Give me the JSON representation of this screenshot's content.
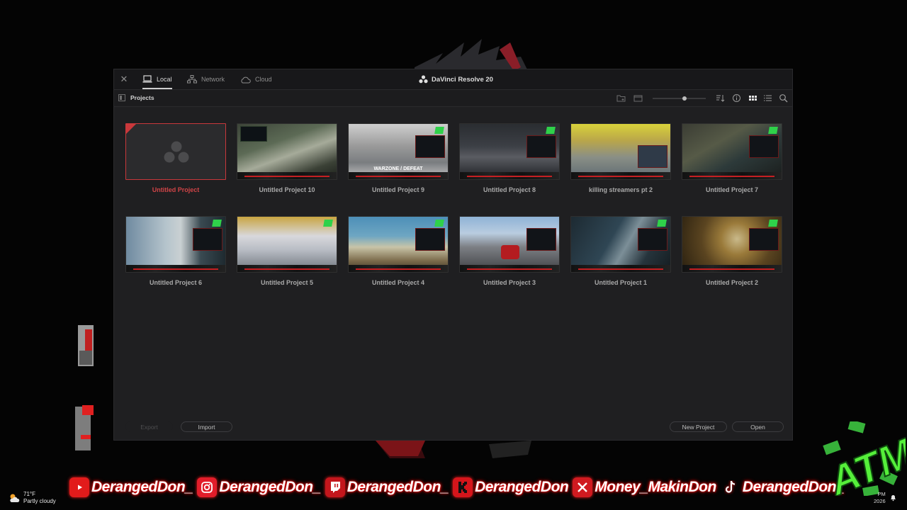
{
  "window": {
    "app_title": "DaVinci Resolve 20",
    "tabs": [
      {
        "label": "Local",
        "active": true
      },
      {
        "label": "Network",
        "active": false
      },
      {
        "label": "Cloud",
        "active": false
      }
    ],
    "section_title": "Projects",
    "toolbar_icons": [
      "new-folder-icon",
      "folder-icon",
      "sort-icon",
      "info-icon",
      "grid-view-icon",
      "list-view-icon",
      "search-icon"
    ],
    "projects_row1": [
      {
        "name": "Untitled Project",
        "selected": true
      },
      {
        "name": "Untitled Project 10"
      },
      {
        "name": "Untitled Project 9",
        "overlay_text": "WARZONE / DEFEAT"
      },
      {
        "name": "Untitled Project 8"
      },
      {
        "name": "killing streamers pt 2"
      },
      {
        "name": "Untitled Project 7"
      }
    ],
    "projects_row2": [
      {
        "name": "Untitled Project 6"
      },
      {
        "name": "Untitled Project 5"
      },
      {
        "name": "Untitled Project 4"
      },
      {
        "name": "Untitled Project 3"
      },
      {
        "name": "Untitled Project 1"
      },
      {
        "name": "Untitled Project 2"
      }
    ],
    "buttons": {
      "export": "Export",
      "import": "Import",
      "new_project": "New Project",
      "open": "Open"
    },
    "accent_color": "#c9383b"
  },
  "banner": {
    "socials": [
      {
        "platform": "youtube",
        "icon": "youtube-icon",
        "handle": "DerangedDon_"
      },
      {
        "platform": "instagram",
        "icon": "instagram-icon",
        "handle": "DerangedDon_"
      },
      {
        "platform": "twitch",
        "icon": "twitch-icon",
        "handle": "DerangedDon_"
      },
      {
        "platform": "kick",
        "icon": "kick-icon",
        "handle": "DerangedDon"
      },
      {
        "platform": "x",
        "icon": "x-icon",
        "handle": "Money_MakinDon"
      },
      {
        "platform": "tiktok",
        "icon": "tiktok-icon",
        "handle": "DerangedDon_"
      }
    ],
    "logo_text": "ATM"
  },
  "taskbar": {
    "temperature": "71°F",
    "condition": "Partly cloudy",
    "time_suffix": "PM",
    "date_fragment": "2026"
  }
}
